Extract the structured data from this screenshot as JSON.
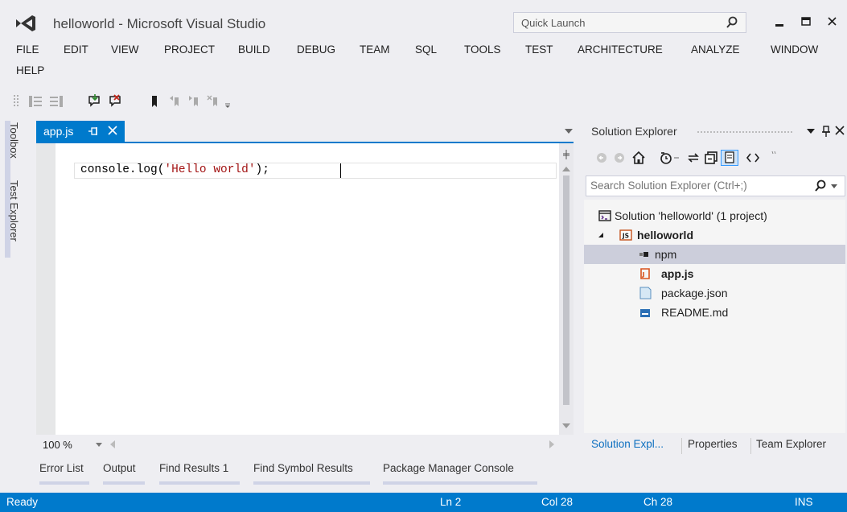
{
  "window": {
    "title": "helloworld - Microsoft Visual Studio",
    "quick_launch_placeholder": "Quick Launch",
    "accent_color": "#007acc"
  },
  "menu": {
    "items": [
      "FILE",
      "EDIT",
      "VIEW",
      "PROJECT",
      "BUILD",
      "DEBUG",
      "TEAM",
      "SQL",
      "TOOLS",
      "TEST",
      "ARCHITECTURE",
      "ANALYZE",
      "WINDOW",
      "HELP"
    ]
  },
  "toolbar": {
    "icons": [
      "toolbar-grip-icon",
      "outdent-icon",
      "indent-icon",
      "comment-icon",
      "uncomment-icon",
      "bookmark-icon",
      "prev-bookmark-icon",
      "next-bookmark-icon",
      "clear-bookmarks-icon",
      "toolbar-options-icon"
    ]
  },
  "side_tabs": {
    "toolbox": "Toolbox",
    "test_explorer": "Test Explorer"
  },
  "document": {
    "tab_label": "app.js",
    "code_prefix": "console.log(",
    "code_string": "'Hello world'",
    "code_suffix": ");",
    "zoom": "100 %"
  },
  "tool_tabs": [
    "Error List",
    "Output",
    "Find Results 1",
    "Find Symbol Results",
    "Package Manager Console"
  ],
  "solution_explorer": {
    "title": "Solution Explorer",
    "search_placeholder": "Search Solution Explorer (Ctrl+;)",
    "tree": [
      {
        "label": "Solution 'helloworld' (1 project)",
        "icon": "solution-icon",
        "bold": false,
        "selected": false
      },
      {
        "label": "helloworld",
        "icon": "js-project-icon",
        "bold": true,
        "selected": false,
        "expanded": true
      },
      {
        "label": "npm",
        "icon": "npm-icon",
        "bold": false,
        "selected": true
      },
      {
        "label": "app.js",
        "icon": "js-file-icon",
        "bold": true,
        "selected": false
      },
      {
        "label": "package.json",
        "icon": "json-file-icon",
        "bold": false,
        "selected": false
      },
      {
        "label": "README.md",
        "icon": "markdown-file-icon",
        "bold": false,
        "selected": false
      }
    ],
    "bottom_tabs": [
      "Solution Expl...",
      "Properties",
      "Team Explorer"
    ]
  },
  "status": {
    "state": "Ready",
    "line": "Ln 2",
    "col": "Col 28",
    "ch": "Ch 28",
    "mode": "INS"
  }
}
